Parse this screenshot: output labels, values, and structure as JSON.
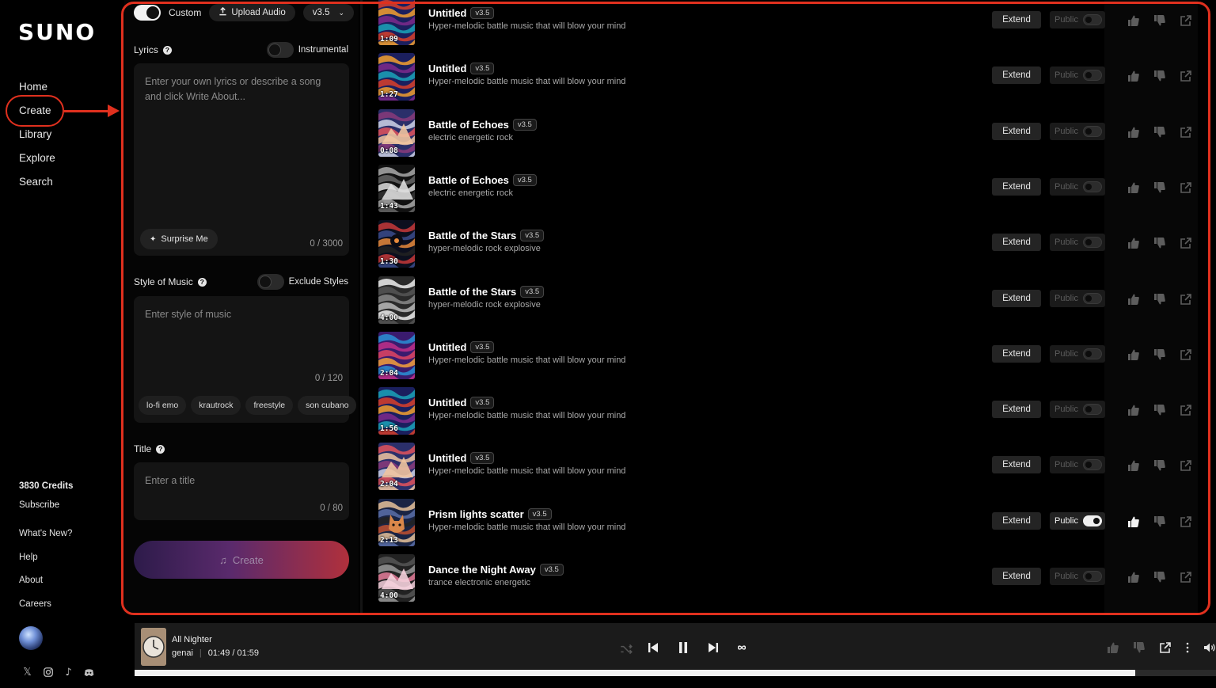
{
  "sidebar": {
    "logo": "SUNO",
    "nav": [
      {
        "label": "Home"
      },
      {
        "label": "Create"
      },
      {
        "label": "Library"
      },
      {
        "label": "Explore"
      },
      {
        "label": "Search"
      }
    ],
    "credits": "3830 Credits",
    "subscribe": "Subscribe",
    "footer_links": [
      "What's New?",
      "Help",
      "About",
      "Careers"
    ],
    "social_icons": [
      "x-icon",
      "instagram-icon",
      "tiktok-icon",
      "discord-icon"
    ]
  },
  "create_panel": {
    "custom_label": "Custom",
    "custom_on": true,
    "upload_label": "Upload Audio",
    "version_select": "v3.5",
    "lyrics_label": "Lyrics",
    "instrumental_label": "Instrumental",
    "lyrics_placeholder": "Enter your own lyrics or describe a song and click Write About...",
    "surprise_label": "Surprise Me",
    "lyrics_counter": "0 / 3000",
    "style_label": "Style of Music",
    "exclude_label": "Exclude Styles",
    "style_placeholder": "Enter style of music",
    "style_counter": "0 / 120",
    "style_tags": [
      "lo-fi emo",
      "krautrock",
      "freestyle",
      "son cubano"
    ],
    "title_label": "Title",
    "title_placeholder": "Enter a title",
    "title_counter": "0 / 80",
    "create_button": "Create"
  },
  "songs": [
    {
      "title": "Untitled",
      "version": "v3.5",
      "description": "Hyper-melodic battle music that will blow your mind",
      "duration": "1:09",
      "public": false,
      "liked": false,
      "art": "fire"
    },
    {
      "title": "Untitled",
      "version": "v3.5",
      "description": "Hyper-melodic battle music that will blow your mind",
      "duration": "1:27",
      "public": false,
      "liked": false,
      "art": "fire"
    },
    {
      "title": "Battle of Echoes",
      "version": "v3.5",
      "description": "electric energetic rock",
      "duration": "0:08",
      "public": false,
      "liked": false,
      "art": "mountain"
    },
    {
      "title": "Battle of Echoes",
      "version": "v3.5",
      "description": "electric energetic rock",
      "duration": "1:43",
      "public": false,
      "liked": false,
      "art": "mono"
    },
    {
      "title": "Battle of the Stars",
      "version": "v3.5",
      "description": "hyper-melodic rock explosive",
      "duration": "1:30",
      "public": false,
      "liked": false,
      "art": "eye"
    },
    {
      "title": "Battle of the Stars",
      "version": "v3.5",
      "description": "hyper-melodic rock explosive",
      "duration": "4:00",
      "public": false,
      "liked": false,
      "art": "gray"
    },
    {
      "title": "Untitled",
      "version": "v3.5",
      "description": "Hyper-melodic battle music that will blow your mind",
      "duration": "2:04",
      "public": false,
      "liked": false,
      "art": "swirl"
    },
    {
      "title": "Untitled",
      "version": "v3.5",
      "description": "Hyper-melodic battle music that will blow your mind",
      "duration": "1:56",
      "public": false,
      "liked": false,
      "art": "fire"
    },
    {
      "title": "Untitled",
      "version": "v3.5",
      "description": "Hyper-melodic battle music that will blow your mind",
      "duration": "2:04",
      "public": false,
      "liked": false,
      "art": "mountain"
    },
    {
      "title": "Prism lights scatter",
      "version": "v3.5",
      "description": "Hyper-melodic battle music that will blow your mind",
      "duration": "2:13",
      "public": true,
      "liked": true,
      "art": "cat"
    },
    {
      "title": "Dance the Night Away",
      "version": "v3.5",
      "description": "trance electronic energetic",
      "duration": "4:00",
      "public": false,
      "liked": false,
      "art": "pinkmono"
    }
  ],
  "row_labels": {
    "extend": "Extend",
    "public": "Public"
  },
  "player": {
    "title": "All Nighter",
    "artist": "genai",
    "time": "01:49 / 01:59",
    "progress": 0.925
  },
  "colors": {
    "highlight": "#e0301e",
    "accent_gradient_start": "#2d1b4a",
    "accent_gradient_end": "#b0303c"
  }
}
